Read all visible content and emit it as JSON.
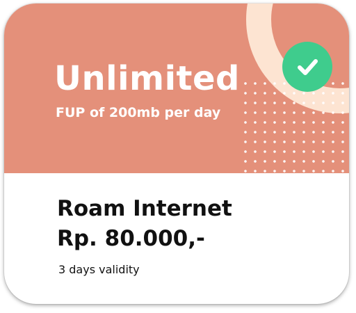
{
  "colors": {
    "header_background": "#e4907a",
    "decoration_ring": "#fde4d2",
    "check_badge": "#3fcc8d",
    "header_text": "#ffffff",
    "body_text": "#111111"
  },
  "card": {
    "header": {
      "title": "Unlimited",
      "subtitle": "FUP of 200mb per day",
      "badge_icon": "check-icon"
    },
    "body": {
      "product_name": "Roam Internet",
      "price": "Rp. 80.000,-",
      "validity": "3 days validity"
    }
  }
}
